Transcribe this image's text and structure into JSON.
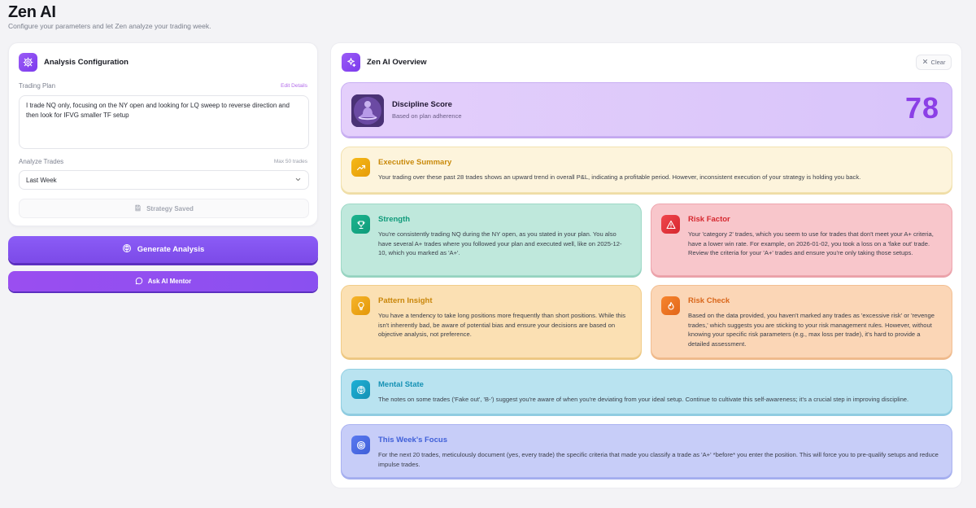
{
  "app": {
    "title": "Zen AI",
    "subtitle": "Configure your parameters and let Zen analyze your trading week."
  },
  "config": {
    "title": "Analysis Configuration",
    "plan_label": "Trading Plan",
    "edit_link": "Edit Details",
    "plan_text": "I trade NQ only, focusing on the NY open and looking for LQ sweep to reverse direction and then look for IFVG smaller TF setup",
    "analyze_label": "Analyze Trades",
    "max_label": "Max 50 trades",
    "selected_range": "Last Week",
    "saved_label": "Strategy Saved"
  },
  "actions": {
    "generate": "Generate Analysis",
    "mentor": "Ask AI Mentor"
  },
  "overview": {
    "title": "Zen AI Overview",
    "clear": "Clear",
    "score": {
      "title": "Discipline Score",
      "subtitle": "Based on plan adherence",
      "value": "78"
    },
    "cards": {
      "summary": {
        "title": "Executive Summary",
        "body": "Your trading over these past 28 trades shows an upward trend in overall P&L, indicating a profitable period. However, inconsistent execution of your strategy is holding you back."
      },
      "strength": {
        "title": "Strength",
        "body": "You're consistently trading NQ during the NY open, as you stated in your plan. You also have several A+ trades where you followed your plan and executed well, like on 2025-12-10, which you marked as 'A+'."
      },
      "risk_factor": {
        "title": "Risk Factor",
        "body": "Your 'category 2' trades, which you seem to use for trades that don't meet your A+ criteria, have a lower win rate. For example, on 2026-01-02, you took a loss on a 'fake out' trade. Review the criteria for your 'A+' trades and ensure you're only taking those setups."
      },
      "pattern": {
        "title": "Pattern Insight",
        "body": "You have a tendency to take long positions more frequently than short positions. While this isn't inherently bad, be aware of potential bias and ensure your decisions are based on objective analysis, not preference."
      },
      "risk_check": {
        "title": "Risk Check",
        "body": "Based on the data provided, you haven't marked any trades as 'excessive risk' or 'revenge trades,' which suggests you are sticking to your risk management rules. However, without knowing your specific risk parameters (e.g., max loss per trade), it's hard to provide a detailed assessment."
      },
      "mental": {
        "title": "Mental State",
        "body": "The notes on some trades ('Fake out', 'B-') suggest you're aware of when you're deviating from your ideal setup. Continue to cultivate this self-awareness; it's a crucial step in improving discipline."
      },
      "focus": {
        "title": "This Week's Focus",
        "body": "For the next 20 trades, meticulously document (yes, every trade) the specific criteria that made you classify a trade as 'A+' *before* you enter the position. This will force you to pre-qualify setups and reduce impulse trades."
      }
    }
  },
  "colors": {
    "accent": "#8b5cf6",
    "score_value": "#8b3fe6",
    "summary_title": "#c98a0c",
    "strength_title": "#0f9a7a",
    "risk_title": "#d6282f",
    "pattern_title": "#c9860a",
    "risk_check_title": "#d9661a",
    "mental_title": "#1591b4",
    "focus_title": "#3f5fd8"
  },
  "icons": {
    "config": "gear-icon",
    "overview": "sparkles-icon",
    "clear": "close-icon",
    "saved": "save-icon",
    "generate": "brain-icon",
    "mentor": "chat-icon",
    "summary": "trend-up-icon",
    "strength": "trophy-icon",
    "risk_factor": "warning-icon",
    "pattern": "lightbulb-icon",
    "risk_check": "flame-icon",
    "mental": "brain-icon",
    "focus": "target-icon"
  }
}
